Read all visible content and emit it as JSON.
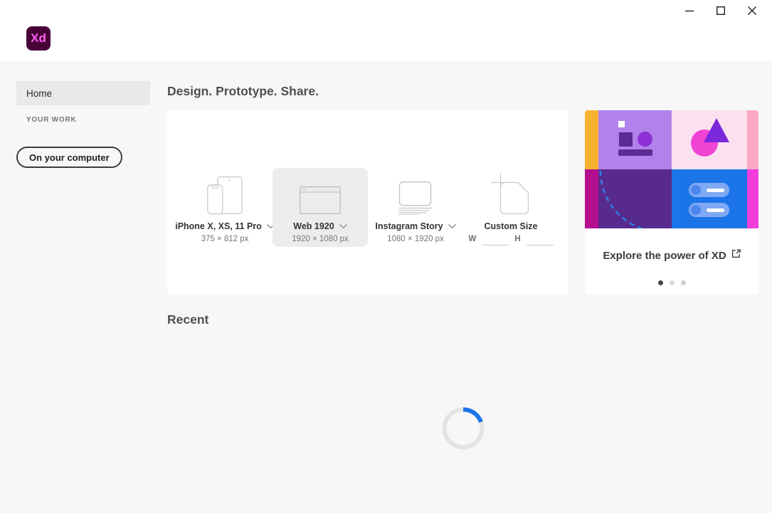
{
  "titlebar": {
    "logo_text": "Xd"
  },
  "sidebar": {
    "home_label": "Home",
    "your_work_label": "YOUR WORK",
    "on_your_computer_label": "On your computer"
  },
  "main": {
    "heading": "Design. Prototype. Share.",
    "recent_heading": "Recent"
  },
  "templates": [
    {
      "name": "iPhone X, XS, 11 Pro",
      "size": "375 × 812 px",
      "selected": false,
      "icon": "phone-tablet-icon",
      "has_dropdown": true
    },
    {
      "name": "Web 1920",
      "size": "1920 × 1080 px",
      "selected": true,
      "icon": "browser-window-icon",
      "has_dropdown": true
    },
    {
      "name": "Instagram Story",
      "size": "1080 × 1920 px",
      "selected": false,
      "icon": "story-screen-icon",
      "has_dropdown": true
    },
    {
      "name": "Custom Size",
      "selected": false,
      "icon": "custom-document-icon",
      "has_dropdown": false,
      "width_label": "W",
      "height_label": "H",
      "width_value": "",
      "height_value": ""
    }
  ],
  "promo": {
    "title": "Explore the power of XD",
    "dots_total": 3,
    "active_dot": 1
  },
  "state": {
    "recent_loading": true
  },
  "colors": {
    "accent_blue": "#1B74E8",
    "logo_bg": "#470137",
    "logo_text": "#FF61F6",
    "selected_template_bg": "#ececec",
    "artwork_palette": {
      "yellow_strip": "#F7B32F",
      "magenta_strip": "#B30F8E",
      "light_purple_quadrant": "#B183EA",
      "light_pink_quadrant": "#FBE0F0",
      "dark_purple_quadrant": "#582A8D",
      "blue_quadrant": "#1B74E8",
      "salmon_strip": "#F9A9C4",
      "bright_magenta_strip": "#F13CDB",
      "shape_dark_purple": "#5C2B94",
      "shape_violet_circle": "#8E2FD7",
      "shape_pink_circle": "#F044D4",
      "shape_purple_triangle": "#7B27DB",
      "toggle_pill": "#7FA9F2"
    }
  }
}
